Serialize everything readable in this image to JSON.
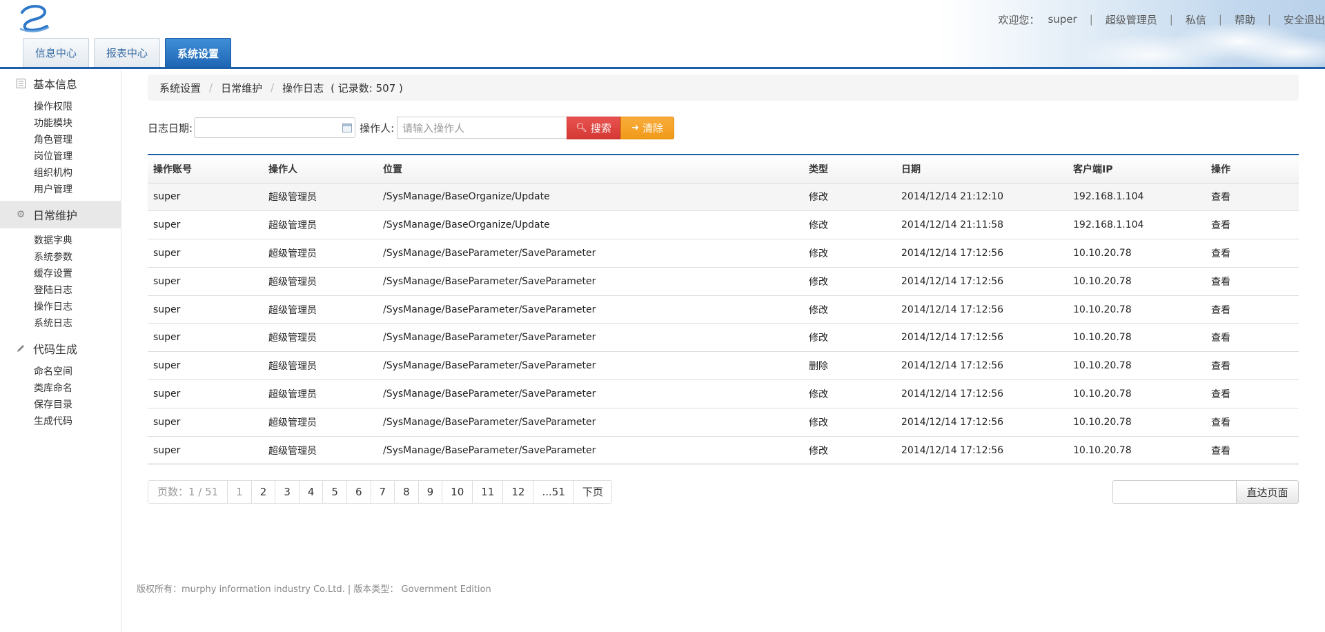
{
  "header": {
    "welcome": "欢迎您：",
    "user": "super",
    "role": "超级管理员",
    "messages": "私信",
    "help": "帮助",
    "logout": "安全退出"
  },
  "tabs": [
    {
      "label": "信息中心"
    },
    {
      "label": "报表中心"
    },
    {
      "label": "系统设置"
    }
  ],
  "sidebar": {
    "groups": [
      {
        "label": "基本信息",
        "icon": "list-icon",
        "items": [
          "操作权限",
          "功能模块",
          "角色管理",
          "岗位管理",
          "组织机构",
          "用户管理"
        ]
      },
      {
        "label": "日常维护",
        "icon": "gear-icon",
        "items": [
          "数据字典",
          "系统参数",
          "缓存设置",
          "登陆日志",
          "操作日志",
          "系统日志"
        ]
      },
      {
        "label": "代码生成",
        "icon": "pencil-icon",
        "items": [
          "命名空间",
          "类库命名",
          "保存目录",
          "生成代码"
        ]
      }
    ]
  },
  "breadcrumb": {
    "level1": "系统设置",
    "level2": "日常维护",
    "level3": "操作日志",
    "count": "( 记录数: 507 )"
  },
  "search": {
    "date_label": "日志日期:",
    "operator_label": "操作人:",
    "operator_placeholder": "请输入操作人",
    "search_button": "搜索",
    "clear_button": "清除"
  },
  "table": {
    "columns": [
      "操作账号",
      "操作人",
      "位置",
      "类型",
      "日期",
      "客户端IP",
      "操作"
    ],
    "rows": [
      [
        "super",
        "超级管理员",
        "/SysManage/BaseOrganize/Update",
        "修改",
        "2014/12/14 21:12:10",
        "192.168.1.104",
        "查看"
      ],
      [
        "super",
        "超级管理员",
        "/SysManage/BaseOrganize/Update",
        "修改",
        "2014/12/14 21:11:58",
        "192.168.1.104",
        "查看"
      ],
      [
        "super",
        "超级管理员",
        "/SysManage/BaseParameter/SaveParameter",
        "修改",
        "2014/12/14 17:12:56",
        "10.10.20.78",
        "查看"
      ],
      [
        "super",
        "超级管理员",
        "/SysManage/BaseParameter/SaveParameter",
        "修改",
        "2014/12/14 17:12:56",
        "10.10.20.78",
        "查看"
      ],
      [
        "super",
        "超级管理员",
        "/SysManage/BaseParameter/SaveParameter",
        "修改",
        "2014/12/14 17:12:56",
        "10.10.20.78",
        "查看"
      ],
      [
        "super",
        "超级管理员",
        "/SysManage/BaseParameter/SaveParameter",
        "修改",
        "2014/12/14 17:12:56",
        "10.10.20.78",
        "查看"
      ],
      [
        "super",
        "超级管理员",
        "/SysManage/BaseParameter/SaveParameter",
        "删除",
        "2014/12/14 17:12:56",
        "10.10.20.78",
        "查看"
      ],
      [
        "super",
        "超级管理员",
        "/SysManage/BaseParameter/SaveParameter",
        "修改",
        "2014/12/14 17:12:56",
        "10.10.20.78",
        "查看"
      ],
      [
        "super",
        "超级管理员",
        "/SysManage/BaseParameter/SaveParameter",
        "修改",
        "2014/12/14 17:12:56",
        "10.10.20.78",
        "查看"
      ],
      [
        "super",
        "超级管理员",
        "/SysManage/BaseParameter/SaveParameter",
        "修改",
        "2014/12/14 17:12:56",
        "10.10.20.78",
        "查看"
      ]
    ]
  },
  "pager": {
    "info": "页数：1 / 51",
    "pages": [
      "1",
      "2",
      "3",
      "4",
      "5",
      "6",
      "7",
      "8",
      "9",
      "10",
      "11",
      "12",
      "...51"
    ],
    "next": "下页",
    "jump_button": "直达页面"
  },
  "footer": {
    "text": "版权所有：murphy information industry Co.Ltd. | 版本类型： Government Edition"
  },
  "colors": {
    "primary": "#1d5fa9",
    "search_button": "#d9534f",
    "clear_button": "#f0ad4e"
  }
}
